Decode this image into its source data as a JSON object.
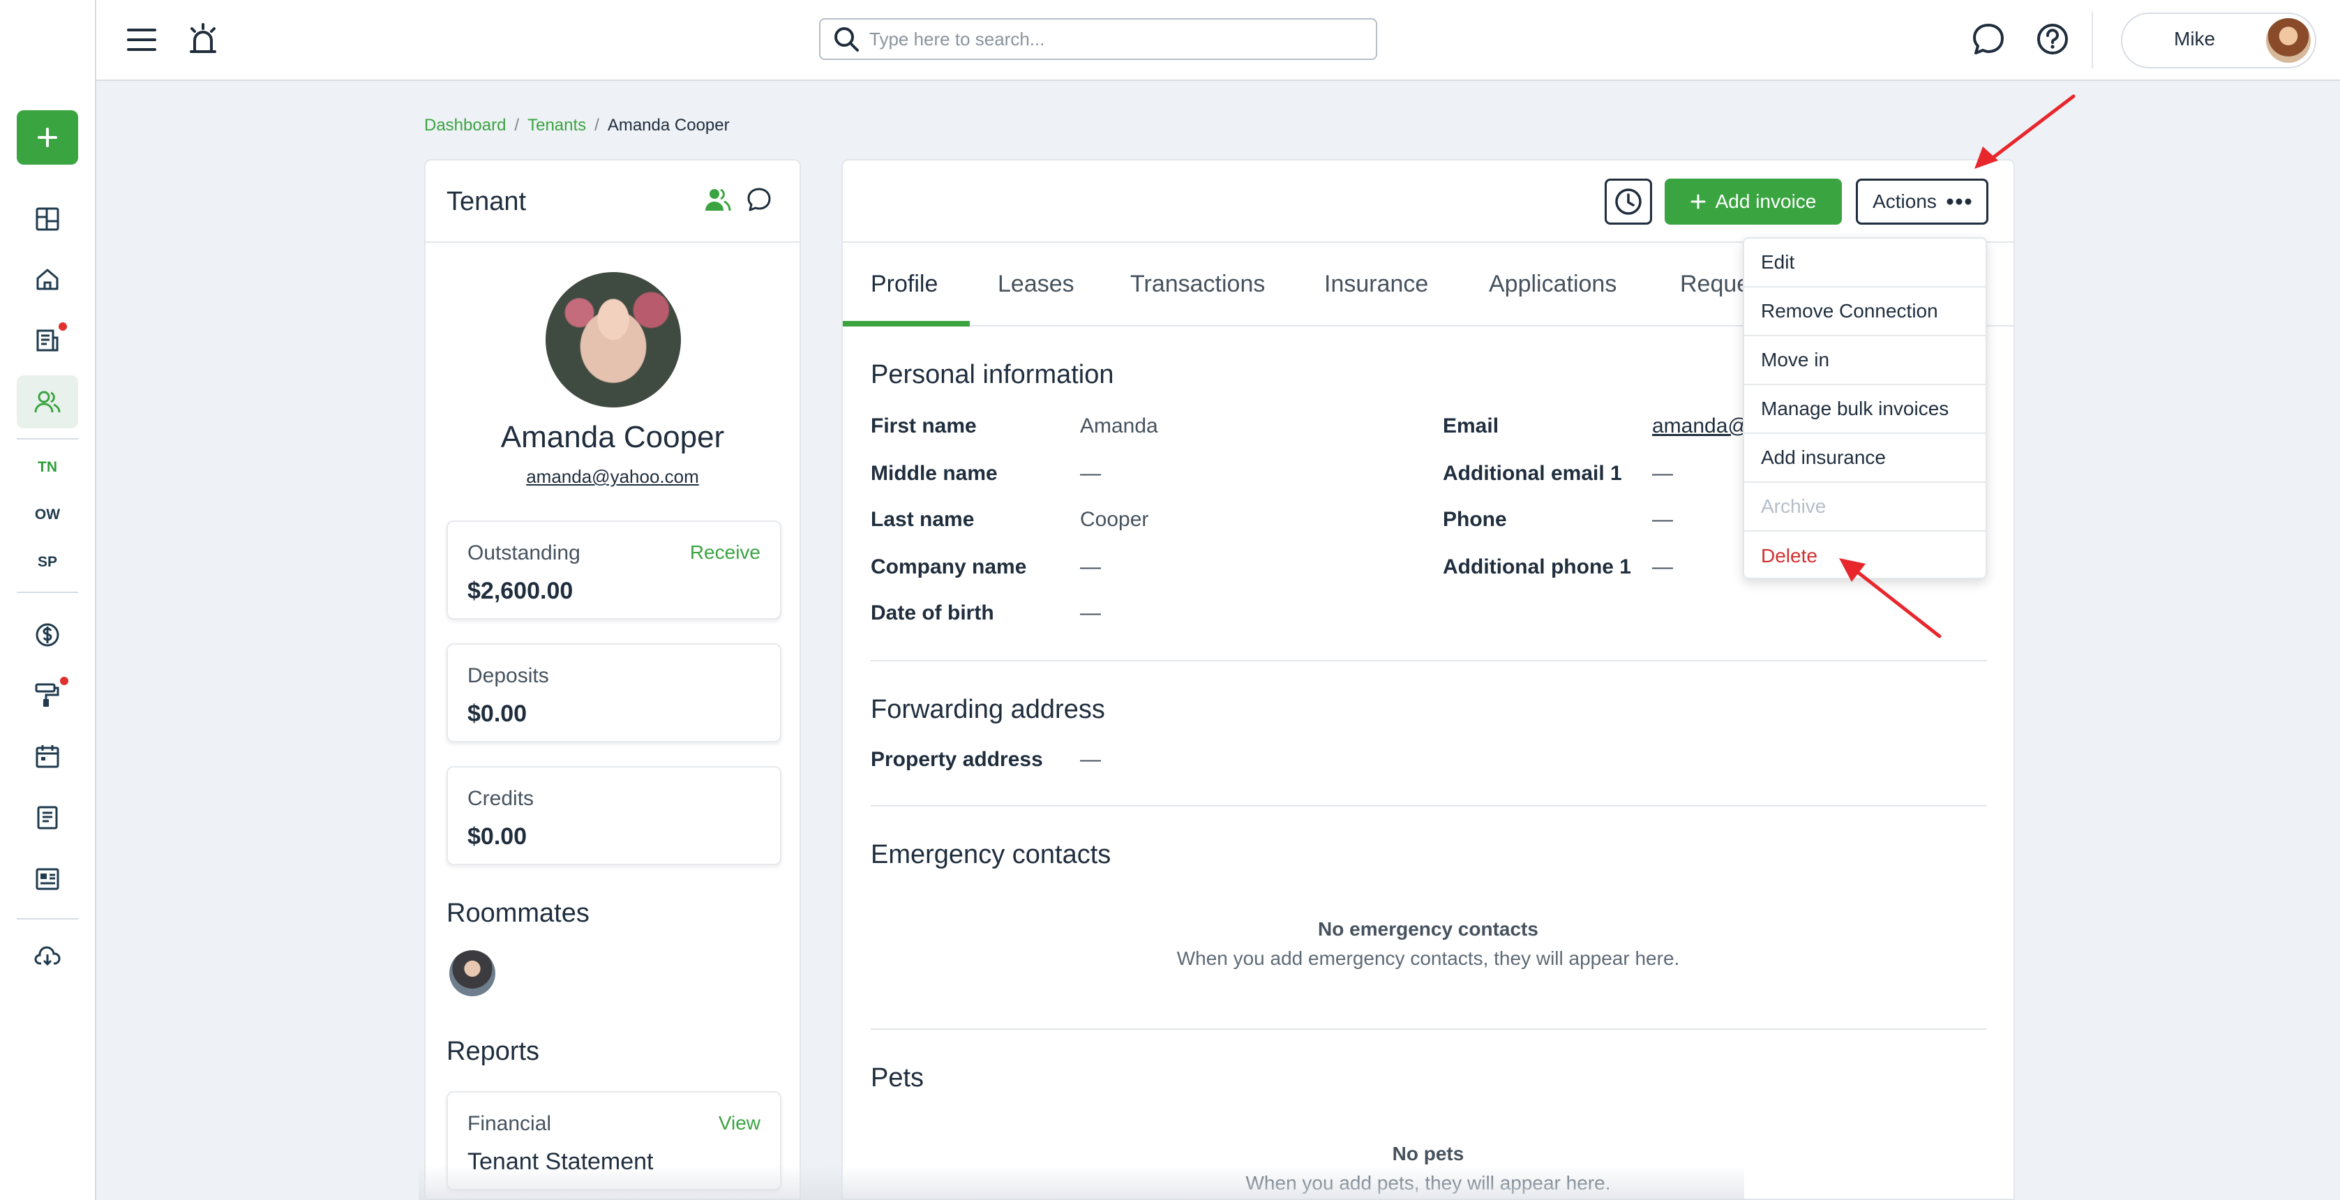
{
  "sidebar": {
    "add_label": "+",
    "items": [
      {
        "name": "dashboard",
        "icon": "dashboard-grid-icon"
      },
      {
        "name": "properties",
        "icon": "home-icon"
      },
      {
        "name": "leases",
        "icon": "document-building-icon",
        "has_badge": true
      },
      {
        "name": "people",
        "icon": "people-icon",
        "active": true
      },
      {
        "name": "accounting",
        "icon": "dollar-circle-icon"
      },
      {
        "name": "maintenance",
        "icon": "paint-roller-icon",
        "has_badge": true
      },
      {
        "name": "calendar",
        "icon": "calendar-icon"
      },
      {
        "name": "reports",
        "icon": "report-icon"
      },
      {
        "name": "listings",
        "icon": "listing-icon"
      },
      {
        "name": "download",
        "icon": "cloud-download-icon"
      }
    ],
    "sub_items": [
      "TN",
      "OW",
      "SP"
    ]
  },
  "topbar": {
    "search_placeholder": "Type here to search...",
    "user_name": "Mike"
  },
  "breadcrumb": {
    "items": [
      "Dashboard",
      "Tenants"
    ],
    "separator": "/",
    "current": "Amanda Cooper"
  },
  "tenant": {
    "panel_title": "Tenant",
    "name": "Amanda Cooper",
    "email": "amanda@yahoo.com",
    "outstanding": {
      "label": "Outstanding",
      "value": "$2,600.00",
      "action": "Receive"
    },
    "deposits": {
      "label": "Deposits",
      "value": "$0.00"
    },
    "credits": {
      "label": "Credits",
      "value": "$0.00"
    },
    "roommates_title": "Roommates",
    "reports_title": "Reports",
    "report": {
      "label": "Financial",
      "value": "Tenant Statement",
      "action": "View"
    }
  },
  "main": {
    "add_invoice_label": "Add invoice",
    "actions_label": "Actions",
    "tabs": [
      "Profile",
      "Leases",
      "Transactions",
      "Insurance",
      "Applications",
      "Reque"
    ],
    "personal": {
      "title": "Personal information",
      "first_name_label": "First name",
      "first_name": "Amanda",
      "middle_name_label": "Middle name",
      "middle_name": "—",
      "last_name_label": "Last name",
      "last_name": "Cooper",
      "company_label": "Company name",
      "company": "—",
      "dob_label": "Date of birth",
      "dob": "—",
      "email_label": "Email",
      "email": "amanda@",
      "add_email_label": "Additional email 1",
      "add_email": "—",
      "phone_label": "Phone",
      "phone": "—",
      "add_phone_label": "Additional phone 1",
      "add_phone": "—"
    },
    "forwarding": {
      "title": "Forwarding address",
      "property_label": "Property address",
      "property": "—"
    },
    "emergency": {
      "title": "Emergency contacts",
      "empty_title": "No emergency contacts",
      "empty_sub": "When you add emergency contacts, they will appear here."
    },
    "pets": {
      "title": "Pets",
      "empty_title": "No pets",
      "empty_sub": "When you add pets, they will appear here."
    }
  },
  "actions_menu": {
    "items": [
      "Edit",
      "Remove Connection",
      "Move in",
      "Manage bulk invoices",
      "Add insurance",
      "Archive",
      "Delete"
    ]
  },
  "colors": {
    "accent": "#3aa441",
    "danger": "#d32f2f",
    "annotation_arrow": "#e8272d"
  }
}
